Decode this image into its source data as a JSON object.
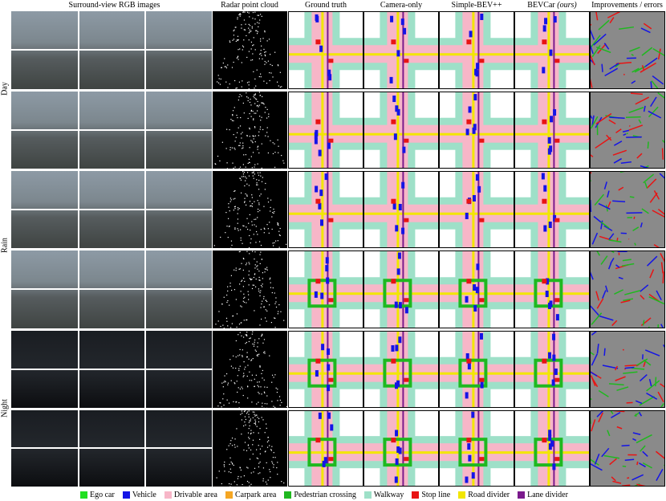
{
  "headers": {
    "rgb": "Surround-view RGB images",
    "radar": "Radar point cloud",
    "gt": "Ground truth",
    "cam": "Camera-only",
    "simple": "Simple-BEV++",
    "bevcar": "BEVCar",
    "bevcar_suffix": "(ours)",
    "improvements": "Improvements / errors"
  },
  "row_labels": {
    "day": "Day",
    "rain": "Rain",
    "night": "Night"
  },
  "legend": [
    {
      "label": "Ego car",
      "color": "#22e022"
    },
    {
      "label": "Vehicle",
      "color": "#1414e6"
    },
    {
      "label": "Drivable area",
      "color": "#f7b6c8"
    },
    {
      "label": "Carpark area",
      "color": "#f5a623"
    },
    {
      "label": "Pedestrian crossing",
      "color": "#1fb81f"
    },
    {
      "label": "Walkway",
      "color": "#9ee0c8"
    },
    {
      "label": "Stop line",
      "color": "#e81414"
    },
    {
      "label": "Road divider",
      "color": "#f2e600"
    },
    {
      "label": "Lane divider",
      "color": "#7a1a8c"
    }
  ],
  "colors": {
    "drivable": "#f7b6c8",
    "walkway": "#9ee0c8",
    "vehicle": "#1414e6",
    "stopline": "#e81414",
    "crossing": "#1fb81f",
    "lane": "#7a1a8c",
    "divider": "#f2e600",
    "carpark": "#f5a623",
    "improve_bg": "#8a8a8a"
  }
}
